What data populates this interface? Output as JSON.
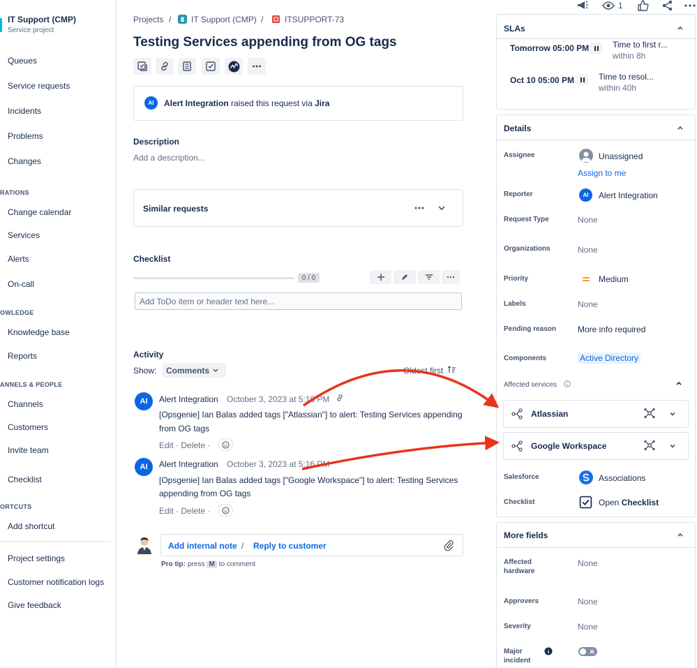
{
  "sidebar": {
    "project_name": "IT Support (CMP)",
    "project_type": "Service project",
    "items": {
      "queues": "Queues",
      "service_requests": "Service requests",
      "incidents": "Incidents",
      "problems": "Problems",
      "changes": "Changes",
      "operations_head": "RATIONS",
      "change_calendar": "Change calendar",
      "services": "Services",
      "alerts": "Alerts",
      "on_call": "On-call",
      "knowledge_head": "OWLEDGE",
      "knowledge_base": "Knowledge base",
      "reports": "Reports",
      "channels_head": "ANNELS & PEOPLE",
      "channels": "Channels",
      "customers": "Customers",
      "invite_team": "Invite team",
      "checklist": "Checklist",
      "shortcuts_head": "ORTCUTS",
      "add_shortcut": "Add shortcut",
      "project_settings": "Project settings",
      "customer_notification_logs": "Customer notification logs",
      "give_feedback": "Give feedback"
    }
  },
  "breadcrumb": {
    "projects": "Projects",
    "sep": "/",
    "project": "IT Support (CMP)",
    "issue_key": "ITSUPPORT-73"
  },
  "issue": {
    "title": "Testing Services appending from OG tags",
    "raised_by_initials": "AI",
    "raised_by": "Alert Integration",
    "raised_text": "raised this request via",
    "raised_via": "Jira"
  },
  "description": {
    "heading": "Description",
    "placeholder": "Add a description..."
  },
  "similar": {
    "label": "Similar requests"
  },
  "checklist": {
    "heading": "Checklist",
    "progress": "0 / 0",
    "input_placeholder": "Add ToDo item or header text here..."
  },
  "activity": {
    "heading": "Activity",
    "show_label": "Show:",
    "filter": "Comments",
    "sort": "Oldest first",
    "comments": [
      {
        "initials": "AI",
        "author": "Alert Integration",
        "date": "October 3, 2023 at 5:16 PM",
        "line1": "[Opsgenie] Ian Balas added tags [\"Atlassian\"] to alert: Testing Services appending",
        "line2": "from OG tags",
        "edit": "Edit",
        "delete": "Delete",
        "dot": "·"
      },
      {
        "initials": "AI",
        "author": "Alert Integration",
        "date": "October 3, 2023 at 5:16 PM",
        "line1": "[Opsgenie] Ian Balas added tags [\"Google Workspace\"] to alert: Testing Services",
        "line2": "appending from OG tags",
        "edit": "Edit",
        "delete": "Delete",
        "dot": "·"
      }
    ],
    "add_internal_note": "Add internal note",
    "slash": "/",
    "reply_to_customer": "Reply to customer",
    "pro_tip_label": "Pro tip:",
    "pro_tip_press": "press",
    "pro_tip_key": "M",
    "pro_tip_suffix": "to comment"
  },
  "top_actions": {
    "watch_count": "1"
  },
  "slas": {
    "heading": "SLAs",
    "items": [
      {
        "time": "Tomorrow 05:00 PM",
        "name": "Time to first r...",
        "remaining": "within 8h"
      },
      {
        "time": "Oct 10 05:00 PM",
        "name": "Time to resol...",
        "remaining": "within 40h"
      }
    ]
  },
  "details": {
    "heading": "Details",
    "assignee_label": "Assignee",
    "assignee": "Unassigned",
    "assign_to_me": "Assign to me",
    "reporter_label": "Reporter",
    "reporter_initials": "AI",
    "reporter": "Alert Integration",
    "request_type_label": "Request Type",
    "request_type": "None",
    "organizations_label": "Organizations",
    "organizations": "None",
    "priority_label": "Priority",
    "priority": "Medium",
    "labels_label": "Labels",
    "labels": "None",
    "pending_reason_label": "Pending reason",
    "pending_reason": "More info required",
    "components_label": "Components",
    "components": "Active Directory",
    "affected_services_label": "Affected services",
    "services": [
      "Atlassian",
      "Google Workspace"
    ],
    "salesforce_label": "Salesforce",
    "salesforce": "Associations",
    "checklist_label": "Checklist",
    "checklist_open": "Open",
    "checklist_bold": "Checklist"
  },
  "more_fields": {
    "heading": "More fields",
    "affected_hardware_l1": "Affected",
    "affected_hardware_l2": "hardware",
    "affected_hardware": "None",
    "approvers_label": "Approvers",
    "approvers": "None",
    "severity_label": "Severity",
    "severity": "None",
    "major_incident_l1": "Major",
    "major_incident_l2": "incident"
  },
  "colors": {
    "accent": "#0c66e4",
    "link": "#0c66e4",
    "annotation_arrow": "#e8341c",
    "priority": "#ff991f"
  }
}
